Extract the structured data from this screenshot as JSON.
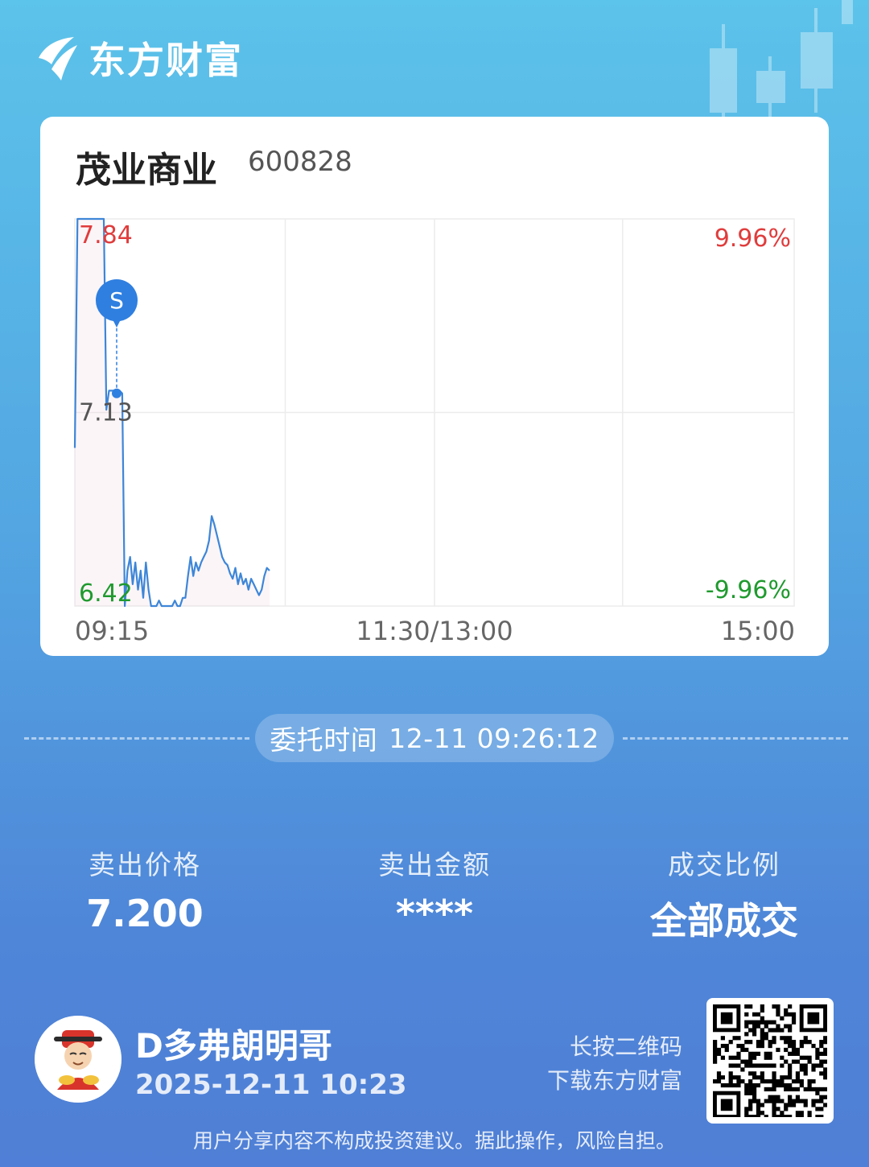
{
  "app": {
    "brand": "东方财富"
  },
  "stock": {
    "name": "茂业商业",
    "code": "600828"
  },
  "chart_data": {
    "type": "line",
    "title": "",
    "y_left_ticks": [
      "7.84",
      "7.13",
      "6.42"
    ],
    "y_right_ticks": [
      "9.96%",
      "-9.96%"
    ],
    "x_ticks": [
      "09:15",
      "11:30/13:00",
      "15:00"
    ],
    "ylim": [
      6.42,
      7.84
    ],
    "reference_price": 7.13,
    "marker": {
      "label": "S",
      "price": 7.2
    },
    "series": [
      {
        "values": [
          7.0,
          7.84,
          7.84,
          7.84,
          7.84,
          7.84,
          7.84,
          7.84,
          7.84,
          7.84,
          7.84,
          7.84,
          7.14,
          7.21,
          7.21,
          7.21,
          7.21,
          7.21,
          7.2,
          6.42,
          6.55,
          6.6,
          6.5,
          6.58,
          6.48,
          6.55,
          6.45,
          6.58,
          6.48,
          6.42,
          6.42,
          6.42,
          6.44,
          6.42,
          6.42,
          6.42,
          6.42,
          6.42,
          6.44,
          6.42,
          6.42,
          6.45,
          6.45,
          6.53,
          6.6,
          6.53,
          6.58,
          6.55,
          6.58,
          6.6,
          6.62,
          6.66,
          6.75,
          6.72,
          6.68,
          6.64,
          6.6,
          6.58,
          6.57,
          6.54,
          6.52,
          6.56,
          6.5,
          6.54,
          6.5,
          6.52,
          6.48,
          6.52,
          6.5,
          6.48,
          6.46,
          6.48,
          6.53,
          6.56,
          6.55
        ]
      }
    ]
  },
  "entrust": {
    "label": "委托时间",
    "datetime": "12-11 09:26:12"
  },
  "stats": [
    {
      "label": "卖出价格",
      "value": "7.200"
    },
    {
      "label": "卖出金额",
      "value": "****"
    },
    {
      "label": "成交比例",
      "value": "全部成交"
    }
  ],
  "user": {
    "name": "D多弗朗明哥",
    "share_time": "2025-12-11 10:23"
  },
  "qr": {
    "hint_line1": "长按二维码",
    "hint_line2": "下载东方财富"
  },
  "footer": {
    "disclaimer": "用户分享内容不构成投资建议。据此操作，风险自担。"
  },
  "colors": {
    "up": "#e03c3c",
    "down": "#1f9a2e",
    "line": "#3d86d8",
    "marker": "#2f7fe0"
  }
}
